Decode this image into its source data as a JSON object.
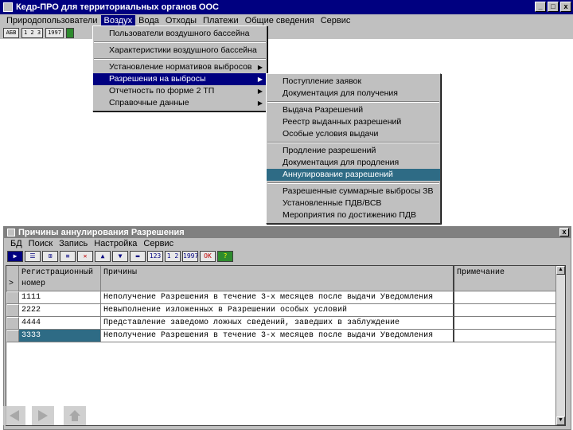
{
  "window": {
    "title": "Кедр-ПРО для территориальных органов ООС",
    "btn_minimize": "_",
    "btn_maximize": "□",
    "btn_close": "x"
  },
  "menubar": [
    "Природопользователи",
    "Воздух",
    "Вода",
    "Отходы",
    "Платежи",
    "Общие сведения",
    "Сервис"
  ],
  "toolbar": [
    "АБВ",
    "1 2 3",
    "1997"
  ],
  "air_menu": {
    "items": [
      "Пользователи воздушного бассейна",
      "Характеристики воздушного бассейна",
      "Установление нормативов выбросов",
      "Разрешения на выбросы",
      "Отчетность по форме 2 ТП",
      "Справочные данные"
    ]
  },
  "permits_submenu": {
    "items": [
      "Поступление заявок",
      "Документация для получения",
      "Выдача Разрешений",
      "Реестр выданных разрешений",
      "Особые условия выдачи",
      "Продление разрешений",
      "Документация для продления",
      "Аннулирование разрешений",
      "Разрешенные суммарные выбросы ЗВ",
      "Установленные ПДВ/ВСВ",
      "Мероприятия по достижению ПДВ"
    ]
  },
  "child": {
    "title": "Причины аннулирования Разрешения",
    "btn_close": "x",
    "menu": [
      "БД",
      "Поиск",
      "Запись",
      "Настройка",
      "Сервис"
    ],
    "toolbar_labels": [
      "123",
      "1 2 3",
      "1997",
      "OK",
      "?"
    ],
    "columns": {
      "reg_number_line1": "Регистрационный",
      "reg_number_line2": "номер",
      "reasons": "Причины",
      "note": "Примечание"
    },
    "row_marker": ">",
    "rows": [
      {
        "reg": "1111",
        "reason": "Неполучение Разрешения в течение 3-х месяцев после выдачи Уведомления",
        "note": ""
      },
      {
        "reg": "2222",
        "reason": "Невыполнение изложенных в Разрешении особых условий",
        "note": ""
      },
      {
        "reg": "4444",
        "reason": "Представление заведомо ложных сведений, заведших в заблуждение",
        "note": ""
      },
      {
        "reg": "3333",
        "reason": "Неполучение Разрешения в течение 3-х месяцев после выдачи Уведомления",
        "note": ""
      }
    ]
  },
  "colors": {
    "titlebar": "#000080",
    "menu_highlight": "#000080",
    "selection": "#2e6b85",
    "chrome": "#c0c0c0"
  }
}
